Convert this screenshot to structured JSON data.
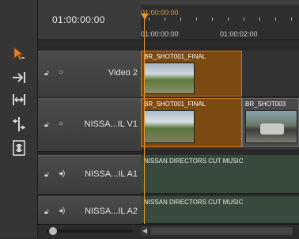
{
  "timeline": {
    "current_timecode": "01:00:00:00",
    "playhead_timecode": "01:00:00:00",
    "ruler_labels": [
      "01:00:00:00",
      "01:00:02:00"
    ],
    "playhead_color": "#e8962c"
  },
  "tools": [
    {
      "name": "selection-tool-icon"
    },
    {
      "name": "track-select-forward-icon"
    },
    {
      "name": "ripple-edit-icon"
    },
    {
      "name": "rolling-edit-icon"
    },
    {
      "name": "slip-tool-icon"
    }
  ],
  "tracks": [
    {
      "id": "video2",
      "label": "Video 2",
      "type": "video"
    },
    {
      "id": "v1",
      "label": "NISSA...IL V1",
      "type": "video"
    },
    {
      "id": "a1",
      "label": "NISSA...IL A1",
      "type": "audio"
    },
    {
      "id": "a2",
      "label": "NISSA...IL A2",
      "type": "audio"
    }
  ],
  "clips": {
    "video2_clip": "BR_SHOT001_FINAL",
    "v1_clip": "BR_SHOT001_FINAL",
    "v1_clip2": "BR_SHOT003",
    "a1_clip": "NISSAN DIRECTORS CUT MUSIC",
    "a2_clip": "NISSAN DIRECTORS CUT MUSIC"
  },
  "colors": {
    "selected_clip": "#7a4a10",
    "clip_border": "#c97a20",
    "audio_clip": "#384a3c"
  }
}
